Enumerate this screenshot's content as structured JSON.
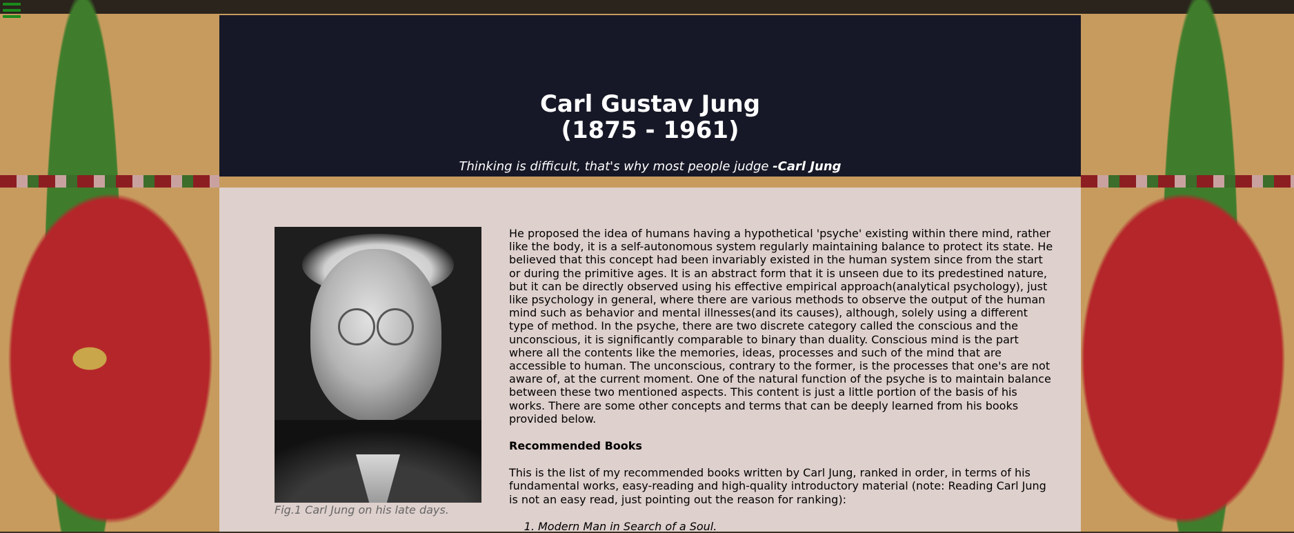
{
  "header": {
    "title_line1": "Carl Gustav Jung",
    "title_line2": "(1875 - 1961)",
    "quote_text": "Thinking is difficult, that's why most people judge ",
    "quote_author": "-Carl Jung"
  },
  "figure": {
    "caption": "Fig.1 Carl Jung on his late days."
  },
  "article": {
    "paragraph": "He proposed the idea of humans having a hypothetical 'psyche' existing within there mind, rather like the body, it is a self-autonomous system regularly maintaining balance to protect its state. He believed that this concept had been invariably existed in the human system since from the start or during the primitive ages. It is an abstract form that it is unseen due to its predestined nature, but it can be directly observed using his effective empirical approach(analytical psychology), just like psychology in general, where there are various methods to observe the output of the human mind such as behavior and mental illnesses(and its causes), although, solely using a different type of method. In the psyche, there are two discrete category called the conscious and the unconscious, it is significantly comparable to binary than duality. Conscious mind is the part where all the contents like the memories, ideas, processes and such of the mind that are accessible to human. The unconscious, contrary to the former, is the processes that one's are not aware of, at the current moment. One of the natural function of the psyche is to maintain balance between these two mentioned aspects. This content is just a little portion of the basis of his works. There are some other concepts and terms that can be deeply learned from his books provided below.",
    "books_heading": "Recommended Books",
    "books_intro": "This is the list of my recommended books written by Carl Jung, ranked in order, in terms of his fundamental works, easy-reading and high-quality introductory material (note: Reading Carl Jung is not an easy read, just pointing out the reason for ranking):",
    "books": [
      "Modern Man in Search of a Soul."
    ]
  },
  "icons": {
    "menu": "hamburger-menu-icon"
  },
  "colors": {
    "header_bg": "#161827",
    "content_bg": "#ded0cc",
    "menu_icon": "#1c8a1c"
  }
}
